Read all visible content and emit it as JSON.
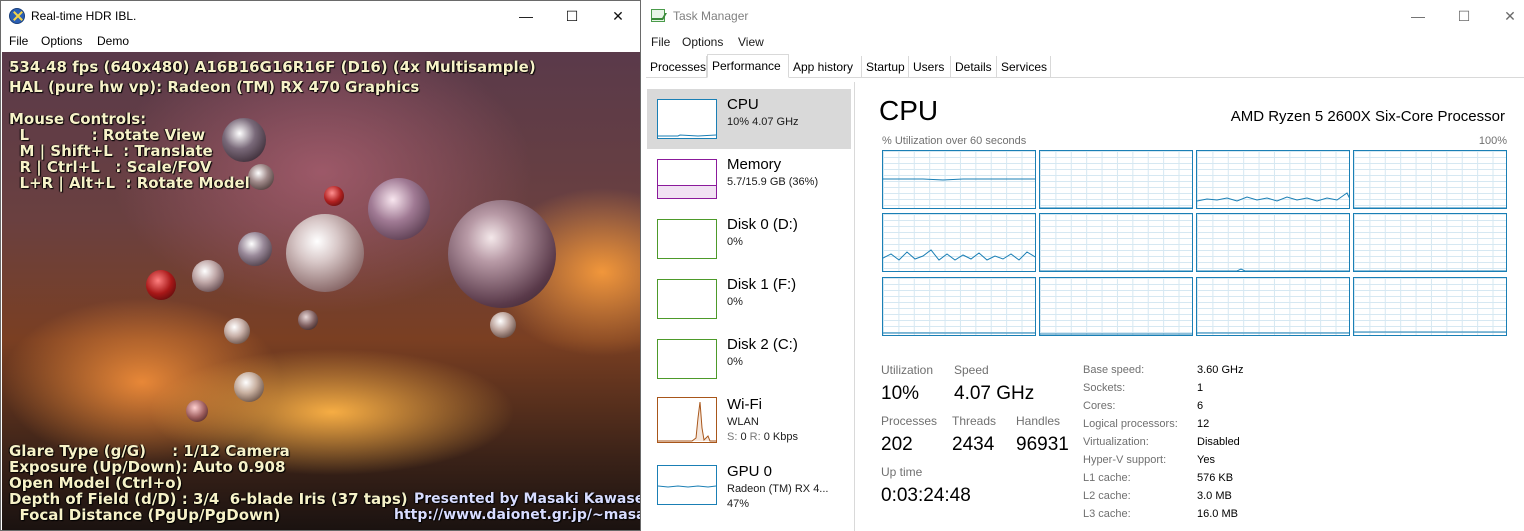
{
  "hdr_window": {
    "title": "Real-time HDR IBL.",
    "menu": [
      "File",
      "Options",
      "Demo"
    ],
    "controls": {
      "minimize": "—",
      "maximize": "☐",
      "close": "✕"
    },
    "hud": {
      "fps_line": "534.48 fps (640x480) A16B16G16R16F (D16) (4x Multisample)",
      "device_line": "HAL (pure hw vp): Radeon (TM) RX 470 Graphics",
      "mouse_title": "Mouse Controls:",
      "mouse_lines": [
        "  L            : Rotate View",
        "  M | Shift+L  : Translate",
        "  R | Ctrl+L   : Scale/FOV",
        "  L+R | Alt+L  : Rotate Model"
      ],
      "bottom_lines": [
        "Glare Type (g/G)     : 1/12 Camera",
        "Exposure (Up/Down): Auto 0.908",
        "Open Model (Ctrl+o)",
        "Depth of Field (d/D) : 3/4  6-blade Iris (37 taps)",
        "  Focal Distance (PgUp/PgDown)"
      ],
      "credit_line1": "Presented by Masaki Kawase.",
      "credit_line2": "http://www.daionet.gr.jp/~masa"
    }
  },
  "task_manager": {
    "title": "Task Manager",
    "menu": [
      "File",
      "Options",
      "View"
    ],
    "controls": {
      "minimize": "—",
      "maximize": "☐",
      "close": "✕"
    },
    "tabs": [
      "Processes",
      "Performance",
      "App history",
      "Startup",
      "Users",
      "Details",
      "Services"
    ],
    "active_tab": "Performance",
    "sidebar": [
      {
        "name": "CPU",
        "sub": "10% 4.07 GHz",
        "color": "#1a7fb5"
      },
      {
        "name": "Memory",
        "sub": "5.7/15.9 GB (36%)",
        "color": "#8b1a9b"
      },
      {
        "name": "Disk 0 (D:)",
        "sub": "0%",
        "color": "#4d9a2a"
      },
      {
        "name": "Disk 1 (F:)",
        "sub": "0%",
        "color": "#4d9a2a"
      },
      {
        "name": "Disk 2 (C:)",
        "sub": "0%",
        "color": "#4d9a2a"
      },
      {
        "name": "Wi-Fi",
        "sub": "WLAN",
        "sub2_s_label": "S:",
        "sub2_s": "0",
        "sub2_r_label": "R:",
        "sub2_r": "0 Kbps",
        "color": "#a8561a"
      },
      {
        "name": "GPU 0",
        "sub": "Radeon (TM) RX 4...",
        "sub2": "47%",
        "color": "#1a7fb5"
      }
    ],
    "cpu_panel": {
      "heading": "CPU",
      "model": "AMD Ryzen 5 2600X Six-Core Processor",
      "util_caption": "% Utilization over 60 seconds",
      "util_max": "100%",
      "core_count_shown": 12,
      "stats": {
        "utilization_label": "Utilization",
        "utilization": "10%",
        "speed_label": "Speed",
        "speed": "4.07 GHz",
        "processes_label": "Processes",
        "processes": "202",
        "threads_label": "Threads",
        "threads": "2434",
        "handles_label": "Handles",
        "handles": "96931",
        "uptime_label": "Up time",
        "uptime": "0:03:24:48"
      },
      "specs": [
        {
          "key": "Base speed:",
          "value": "3.60 GHz"
        },
        {
          "key": "Sockets:",
          "value": "1"
        },
        {
          "key": "Cores:",
          "value": "6"
        },
        {
          "key": "Logical processors:",
          "value": "12"
        },
        {
          "key": "Virtualization:",
          "value": "Disabled"
        },
        {
          "key": "Hyper-V support:",
          "value": "Yes"
        },
        {
          "key": "L1 cache:",
          "value": "576 KB"
        },
        {
          "key": "L2 cache:",
          "value": "3.0 MB"
        },
        {
          "key": "L3 cache:",
          "value": "16.0 MB"
        }
      ]
    }
  }
}
